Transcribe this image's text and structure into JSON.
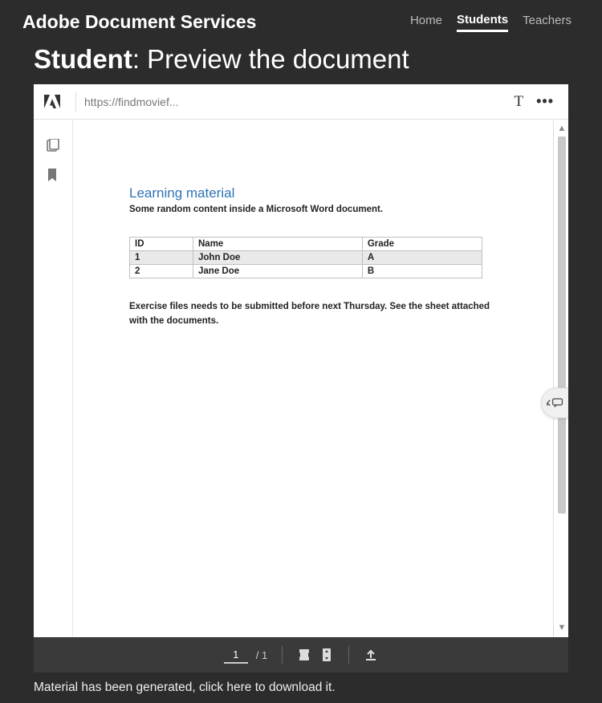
{
  "header": {
    "brand": "Adobe Document Services",
    "nav": [
      {
        "label": "Home",
        "active": false
      },
      {
        "label": "Students",
        "active": true
      },
      {
        "label": "Teachers",
        "active": false
      }
    ]
  },
  "page_title": {
    "prefix": "Student",
    "rest": ": Preview the document"
  },
  "viewer": {
    "url": "https://findmovief...",
    "page_input": "1",
    "page_total": "/ 1"
  },
  "document": {
    "heading": "Learning material",
    "intro": "Some random content inside a Microsoft Word document.",
    "table": {
      "headers": [
        "ID",
        "Name",
        "Grade"
      ],
      "rows": [
        [
          "1",
          "John Doe",
          "A"
        ],
        [
          "2",
          "Jane Doe",
          "B"
        ]
      ]
    },
    "footnote": "Exercise files needs to be submitted before next Thursday. See the sheet attached with the documents."
  },
  "footer_message": "Material has been generated, click here to download it."
}
